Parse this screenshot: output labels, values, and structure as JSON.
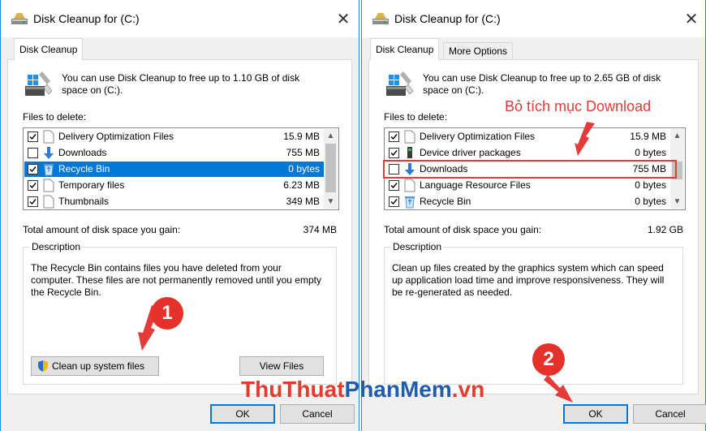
{
  "left": {
    "title": "Disk Cleanup for  (C:)",
    "tabs": [
      {
        "label": "Disk Cleanup"
      }
    ],
    "intro": "You can use Disk Cleanup to free up to 1.10 GB of disk space on  (C:).",
    "files_label": "Files to delete:",
    "files": [
      {
        "name": "Delivery Optimization Files",
        "size": "15.9 MB",
        "checked": true,
        "icon": "file-icon"
      },
      {
        "name": "Downloads",
        "size": "755 MB",
        "checked": false,
        "icon": "download-arrow-icon"
      },
      {
        "name": "Recycle Bin",
        "size": "0 bytes",
        "checked": true,
        "icon": "recycle-bin-icon",
        "selected": true
      },
      {
        "name": "Temporary files",
        "size": "6.23 MB",
        "checked": true,
        "icon": "file-icon"
      },
      {
        "name": "Thumbnails",
        "size": "349 MB",
        "checked": true,
        "icon": "file-icon"
      }
    ],
    "total_label": "Total amount of disk space you gain:",
    "total_value": "374 MB",
    "description_title": "Description",
    "description": "The Recycle Bin contains files you have deleted from your computer. These files are not permanently removed until you empty the Recycle Bin.",
    "cleanup_system_label": "Clean up system files",
    "view_files_label": "View Files",
    "ok_label": "OK",
    "cancel_label": "Cancel",
    "step_badge": "1"
  },
  "right": {
    "title": "Disk Cleanup for  (C:)",
    "tabs": [
      {
        "label": "Disk Cleanup"
      },
      {
        "label": "More Options"
      }
    ],
    "intro": "You can use Disk Cleanup to free up to 2.65 GB of disk space on  (C:).",
    "files_label": "Files to delete:",
    "files": [
      {
        "name": "Delivery Optimization Files",
        "size": "15.9 MB",
        "checked": true,
        "icon": "file-icon"
      },
      {
        "name": "Device driver packages",
        "size": "0 bytes",
        "checked": true,
        "icon": "driver-icon"
      },
      {
        "name": "Downloads",
        "size": "755 MB",
        "checked": false,
        "icon": "download-arrow-icon"
      },
      {
        "name": "Language Resource Files",
        "size": "0 bytes",
        "checked": true,
        "icon": "file-icon"
      },
      {
        "name": "Recycle Bin",
        "size": "0 bytes",
        "checked": true,
        "icon": "recycle-bin-icon"
      }
    ],
    "total_label": "Total amount of disk space you gain:",
    "total_value": "1.92 GB",
    "description_title": "Description",
    "description": "Clean up files created by the graphics system which can speed up application load time and improve responsiveness. They will be re-generated as needed.",
    "ok_label": "OK",
    "cancel_label": "Cancel",
    "annotation": "Bỏ tích mục Download",
    "step_badge": "2"
  },
  "watermark": {
    "part_a": "ThuThuat",
    "part_b": "PhanMem",
    "part_c": ".vn"
  },
  "colors": {
    "accent": "#0078d7",
    "annotation": "#e43a3a",
    "watermark_red": "#e53b2c",
    "watermark_blue": "#1f5cad"
  }
}
